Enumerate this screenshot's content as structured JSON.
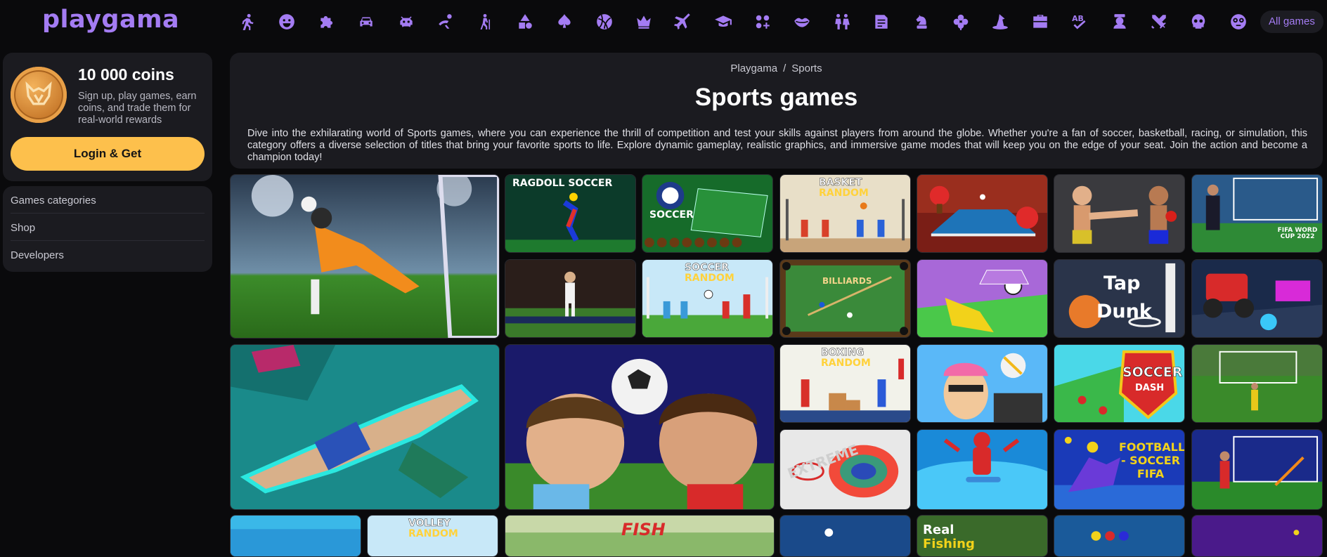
{
  "brand": {
    "logo_text": "playgama",
    "accent": "#a47cf3",
    "cta_color": "#fdc04c"
  },
  "topnav": {
    "category_icons": [
      "runner-icon",
      "smile-icon",
      "puzzle-icon",
      "car-icon",
      "alien-icon",
      "shooter-icon",
      "hiker-icon",
      "shapes-icon",
      "spade-icon",
      "ball-icon",
      "crown-icon",
      "plane-icon",
      "graduation-cap-icon",
      "dots-plus-icon",
      "lips-icon",
      "couple-icon",
      "notes-icon",
      "chess-knight-icon",
      "clover-icon",
      "witch-hat-icon",
      "briefcase-icon",
      "word-icon",
      "bear-icon",
      "swords-icon",
      "skull-icon",
      "face-icon"
    ],
    "all_games_label": "All games"
  },
  "sidebar": {
    "coins_title": "10 000 coins",
    "coins_desc": "Sign up, play games, earn coins, and trade them for real-world rewards",
    "login_label": "Login & Get",
    "nav": [
      "Games categories",
      "Shop",
      "Developers"
    ]
  },
  "hero": {
    "breadcrumb": [
      "Playgama",
      "Sports"
    ],
    "breadcrumb_sep": "/",
    "title": "Sports games",
    "description": "Dive into the exhilarating world of Sports games, where you can experience the thrill of competition and test your skills against players from around the globe. Whether you're a fan of soccer, basketball, racing, or simulation, this category offers a diverse selection of titles that bring your favorite sports to life. Explore dynamic gameplay, realistic graphics, and immersive game modes that will keep you on the edge of your seat. Join the action and become a champion today!"
  },
  "tile_labels": {
    "ragdoll": "RAGDOLL SOCCER",
    "finger_soccer": "SOCCER",
    "basket_random_1": "BASKET",
    "basket_random_2": "RANDOM",
    "soccer_random_1": "SOCCER",
    "soccer_random_2": "RANDOM",
    "billiards": "BILLIARDS",
    "tap_dunk_1": "Tap",
    "tap_dunk_2": "Dunk",
    "fifa_wc": "FIFA WORD CUP 2022",
    "boxing_random_1": "BOXING",
    "boxing_random_2": "RANDOM",
    "soccer_dash_1": "SOCCER",
    "soccer_dash_2": "DASH",
    "football_fifa": "FOOTBALL - SOCCER FIFA",
    "extreme": "EXTREME",
    "volley_random_1": "VOLLEY",
    "volley_random_2": "RANDOM",
    "fish": "FISH",
    "real_fishing_1": "Real",
    "real_fishing_2": "Fishing"
  }
}
